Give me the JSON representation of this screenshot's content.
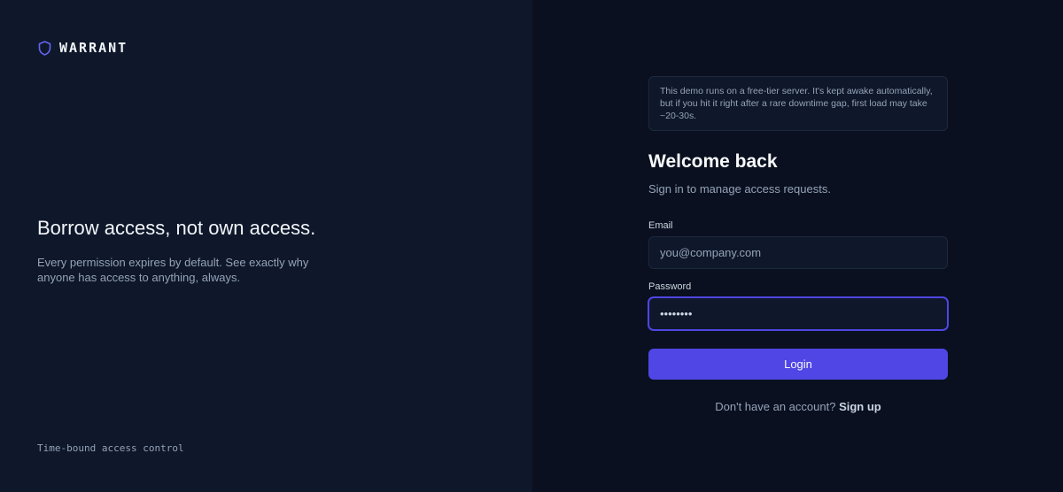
{
  "brand": {
    "name": "WARRANT",
    "icon": "shield-icon",
    "accent": "#4f46e5"
  },
  "hero": {
    "title": "Borrow access, not own access.",
    "subtitle": "Every permission expires by default. See exactly why anyone has access to anything, always."
  },
  "footer": {
    "tagline": "Time-bound access control"
  },
  "notice": {
    "text": "This demo runs on a free-tier server. It's kept awake automatically, but if you hit it right after a rare downtime gap, first load may take ~20-30s."
  },
  "login": {
    "title": "Welcome back",
    "subtitle": "Sign in to manage access requests.",
    "email_label": "Email",
    "email_placeholder": "you@company.com",
    "password_label": "Password",
    "password_value": "••••••••",
    "button_label": "Login",
    "signup_prompt": "Don't have an account?",
    "signup_link": "Sign up"
  },
  "colors": {
    "left_bg": "#0f172a",
    "right_bg": "#0a101f",
    "button_bg": "#4f46e5"
  }
}
